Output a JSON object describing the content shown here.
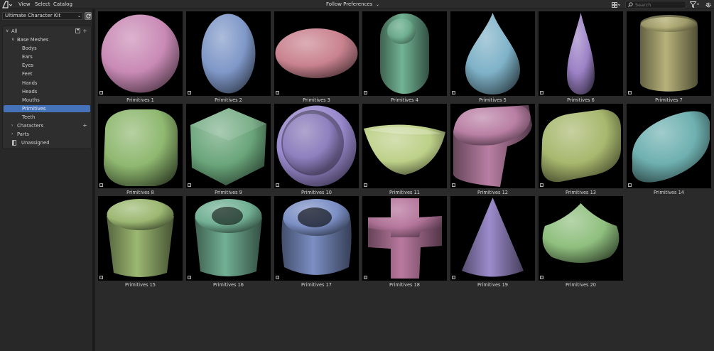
{
  "header": {
    "menus": [
      "View",
      "Select",
      "Catalog"
    ],
    "import_method": "Follow Preferences",
    "search_placeholder": "Search"
  },
  "sidebar": {
    "library": "Ultimate Character Kit",
    "tree": [
      {
        "label": "All",
        "level": 0,
        "expanded": true
      },
      {
        "label": "Base Meshes",
        "level": 1,
        "expanded": true
      },
      {
        "label": "Bodys",
        "level": 2
      },
      {
        "label": "Ears",
        "level": 2
      },
      {
        "label": "Eyes",
        "level": 2
      },
      {
        "label": "Feet",
        "level": 2
      },
      {
        "label": "Hands",
        "level": 2
      },
      {
        "label": "Heads",
        "level": 2
      },
      {
        "label": "Mouths",
        "level": 2
      },
      {
        "label": "Primitives",
        "level": 2,
        "selected": true
      },
      {
        "label": "Teeth",
        "level": 2
      },
      {
        "label": "Characters",
        "level": 1,
        "expanded": false
      },
      {
        "label": "Parts",
        "level": 1,
        "expanded": false
      },
      {
        "label": "Unassigned",
        "level": 1
      }
    ]
  },
  "assets": [
    {
      "name": "Primitives 1",
      "shape": "sphere",
      "color": "#c98ab5"
    },
    {
      "name": "Primitives 2",
      "shape": "ellipsoid",
      "color": "#7f98c8"
    },
    {
      "name": "Primitives 3",
      "shape": "flat-ellipsoid",
      "color": "#c9838f"
    },
    {
      "name": "Primitives 4",
      "shape": "capsule",
      "color": "#72b394"
    },
    {
      "name": "Primitives 5",
      "shape": "teardrop",
      "color": "#7fb2c8"
    },
    {
      "name": "Primitives 6",
      "shape": "slim-teardrop",
      "color": "#9c82c6"
    },
    {
      "name": "Primitives 7",
      "shape": "pill-cylinder",
      "color": "#b7b27a"
    },
    {
      "name": "Primitives 8",
      "shape": "rounded-cube",
      "color": "#8fb870"
    },
    {
      "name": "Primitives 9",
      "shape": "cube",
      "color": "#6aa57a"
    },
    {
      "name": "Primitives 10",
      "shape": "bowl",
      "color": "#9888cc"
    },
    {
      "name": "Primitives 11",
      "shape": "half-bowl",
      "color": "#bdd088"
    },
    {
      "name": "Primitives 12",
      "shape": "stadium-prism",
      "color": "#b97fa4"
    },
    {
      "name": "Primitives 13",
      "shape": "rounded-slab",
      "color": "#a8b86e"
    },
    {
      "name": "Primitives 14",
      "shape": "tilted-disc",
      "color": "#6fb0b0"
    },
    {
      "name": "Primitives 15",
      "shape": "cylinder",
      "color": "#9cb872"
    },
    {
      "name": "Primitives 16",
      "shape": "tube",
      "color": "#72b094"
    },
    {
      "name": "Primitives 17",
      "shape": "torus-tube",
      "color": "#7b8fc4"
    },
    {
      "name": "Primitives 18",
      "shape": "cross",
      "color": "#b9799f"
    },
    {
      "name": "Primitives 19",
      "shape": "cone",
      "color": "#9d8ccc"
    },
    {
      "name": "Primitives 20",
      "shape": "onion",
      "color": "#8fbf7e"
    }
  ]
}
